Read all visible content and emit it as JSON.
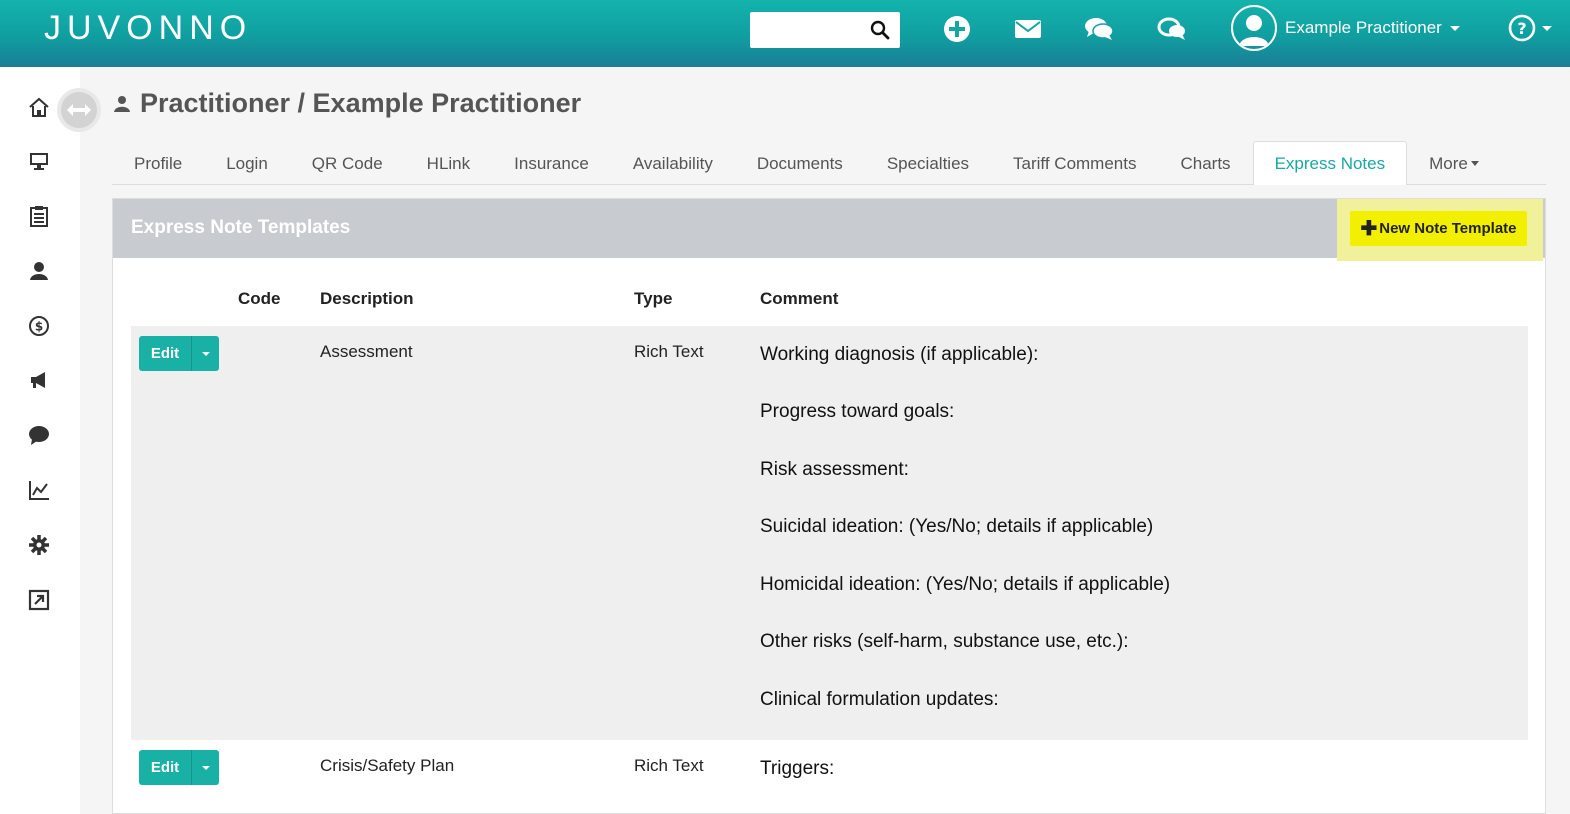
{
  "app": {
    "logo": "JUVONNO",
    "search_placeholder": "",
    "user_name": "Example Practitioner"
  },
  "topbar_icons": [
    "plus-circle-icon",
    "envelope-icon",
    "comments-icon",
    "chat-alt-icon"
  ],
  "sidebar": {
    "items": [
      "home-icon",
      "monitor-icon",
      "clipboard-icon",
      "user-icon",
      "dollar-icon",
      "megaphone-icon",
      "chat-bubble-icon",
      "line-chart-icon",
      "gear-icon",
      "external-link-icon"
    ]
  },
  "page": {
    "title": "Practitioner / Example Practitioner"
  },
  "tabs": [
    {
      "label": "Profile"
    },
    {
      "label": "Login"
    },
    {
      "label": "QR Code"
    },
    {
      "label": "HLink"
    },
    {
      "label": "Insurance"
    },
    {
      "label": "Availability"
    },
    {
      "label": "Documents"
    },
    {
      "label": "Specialties"
    },
    {
      "label": "Tariff Comments"
    },
    {
      "label": "Charts"
    },
    {
      "label": "Express Notes",
      "active": true
    },
    {
      "label": "More"
    }
  ],
  "panel": {
    "title": "Express Note Templates",
    "new_button": "New Note Template",
    "columns": {
      "code": "Code",
      "description": "Description",
      "type": "Type",
      "comment": "Comment"
    },
    "rows": [
      {
        "edit": "Edit",
        "code": "",
        "description": "Assessment",
        "type": "Rich Text",
        "comment_lines": [
          "Working diagnosis (if applicable):",
          "Progress toward goals:",
          "Risk assessment:",
          "Suicidal ideation: (Yes/No; details if applicable)",
          "Homicidal ideation: (Yes/No; details if applicable)",
          "Other risks (self-harm, substance use, etc.):",
          "Clinical formulation updates:"
        ]
      },
      {
        "edit": "Edit",
        "code": "",
        "description": "Crisis/Safety Plan",
        "type": "Rich Text",
        "comment_lines": [
          "Triggers:"
        ]
      }
    ]
  },
  "colors": {
    "accent": "#17a9a5",
    "highlight": "#f2f000"
  }
}
